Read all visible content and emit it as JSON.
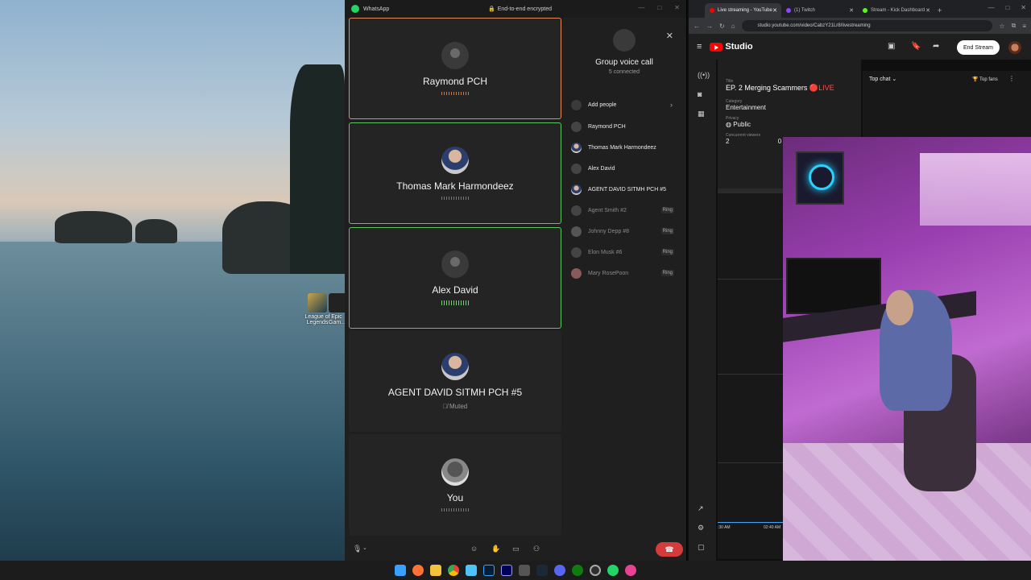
{
  "desktop": {
    "icons": [
      {
        "label": "League of Legends",
        "icon": "league-of-legends-icon"
      },
      {
        "label": "Epic Gam...",
        "icon": "epic-games-icon"
      }
    ]
  },
  "whatsapp": {
    "title": "WhatsApp",
    "encryption": "End-to-end encrypted",
    "tiles": [
      {
        "name": "Raymond PCH",
        "state": "active",
        "status": ""
      },
      {
        "name": "Thomas Mark Harmondeez",
        "state": "speaking",
        "status": ""
      },
      {
        "name": "Alex David",
        "state": "speaking",
        "status": ""
      },
      {
        "name": "AGENT DAVID SITMH PCH #5",
        "state": "normal",
        "status": "Muted"
      },
      {
        "name": "You",
        "state": "normal",
        "status": ""
      }
    ],
    "side": {
      "title": "Group voice call",
      "subtitle": "5 connected",
      "add_people": "Add people",
      "participants": [
        {
          "name": "Raymond PCH",
          "ringing": false
        },
        {
          "name": "Thomas Mark Harmondeez",
          "ringing": false
        },
        {
          "name": "Alex David",
          "ringing": false
        },
        {
          "name": "AGENT DAVID SITMH PCH #5",
          "ringing": false
        },
        {
          "name": "Agent Smith #2",
          "ringing": true
        },
        {
          "name": "Johnny Depp #8",
          "ringing": true
        },
        {
          "name": "Elon Musk #6",
          "ringing": true
        },
        {
          "name": "Mary RosePoon",
          "ringing": true
        }
      ],
      "ring_label": "Ring"
    }
  },
  "browser": {
    "tabs": [
      {
        "label": "Live streaming - YouTube",
        "color": "#ff0000",
        "selected": true
      },
      {
        "label": "(1) Twitch",
        "color": "#9146ff",
        "selected": false
      },
      {
        "label": "Stream - Kick Dashboard",
        "color": "#53fc18",
        "selected": false
      }
    ],
    "url": "studio.youtube.com/video/CabzY21Lr8/livestreaming"
  },
  "youtube": {
    "brand": "Studio",
    "end_stream": "End Stream",
    "title_label": "Title",
    "title_value": "EP. 2 Merging Scammers",
    "live_badge": "🔴LIVE",
    "category_label": "Category",
    "category_value": "Entertainment",
    "privacy_label": "Privacy",
    "privacy_value": "Public",
    "viewers_label": "Concurrent viewers",
    "viewers_value": "2",
    "viewers_value_2": "0",
    "chat_mode": "Top chat",
    "top_fans": "Top fans",
    "timeline_start": ":30 AM",
    "timeline_end": "02:40 AM"
  },
  "taskbar": {
    "icons": [
      "windows-start-icon",
      "firefox-icon",
      "file-explorer-icon",
      "chrome-icon",
      "notepad-icon",
      "photoshop-icon",
      "premiere-icon",
      "calculator-icon",
      "steam-icon",
      "discord-icon",
      "xbox-icon",
      "obs-icon",
      "whatsapp-icon",
      "tool-icon"
    ]
  }
}
